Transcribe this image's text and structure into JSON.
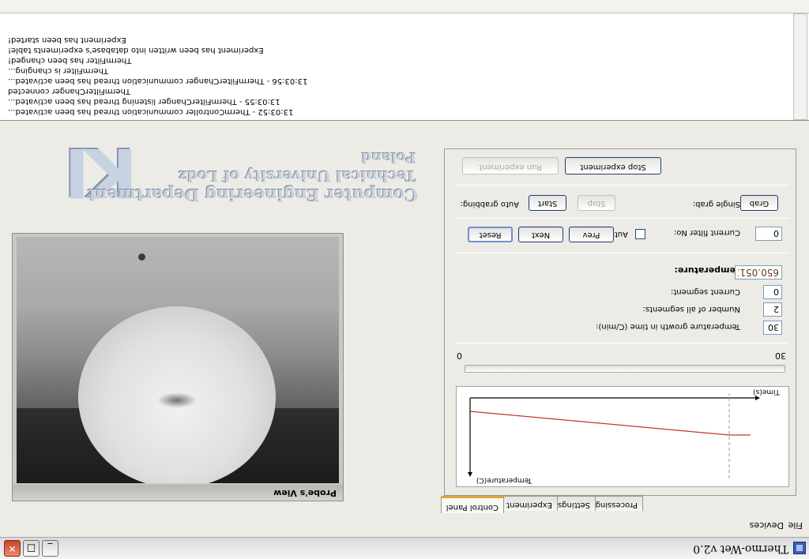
{
  "window": {
    "title": "Thermo-Wet v2.0",
    "minimize": "_",
    "maximize": "□",
    "close": "✕"
  },
  "menu": [
    "File",
    "Devices"
  ],
  "probe": {
    "caption": "Probe's View"
  },
  "logo": {
    "mark": "KI",
    "line1": "Computer Engineering Department",
    "line2": "Technical University of Lodz",
    "line3": "Poland"
  },
  "tabs": [
    "Control Panel",
    "Experiment",
    "Settings",
    "Processing"
  ],
  "active_tab": "Control Panel",
  "graph": {
    "x_label": "Time(s)",
    "y_label": "Temperature(C)"
  },
  "slider": {
    "min_label": "0",
    "max_label": "30",
    "value": 0
  },
  "temperature_growth": {
    "label": "Temperature growth in time (C/min):",
    "value": "30"
  },
  "segments_count": {
    "label": "Number of all segments:",
    "value": "2"
  },
  "current_segment": {
    "label": "Current segment:",
    "value": "0"
  },
  "temperature": {
    "label": "Temperature:",
    "value": "650.0513"
  },
  "filter": {
    "reset": "Reset",
    "next": "Next",
    "prev": "Prev",
    "auto_label": "Auto",
    "auto_checked": false,
    "current_label": "Current filter No:",
    "current_value": "0"
  },
  "grabbing": {
    "auto_label": "Auto grabbing:",
    "start": "Start",
    "stop": "Stop",
    "single_label": "Single grab:",
    "grab": "Grab"
  },
  "experiment_buttons": {
    "run": "Run experiment",
    "stop": "Stop experiment"
  },
  "log": [
    "13:03:52 - ThermController communication thread has been activated...",
    "13:03:55 - ThermFilterChanger listening thread has been activated...",
    "ThermFilterChanger connected",
    "13:03:56 - ThermFilterChanger communication thread has been activated...",
    "ThermFilter is changing...",
    "ThermFilter has been changed!",
    "Experiment has been written into database's experiments table!",
    "Experiment has been started!"
  ],
  "colors": {
    "curve": "#c0392b",
    "accent_tab": "#e5a436"
  }
}
